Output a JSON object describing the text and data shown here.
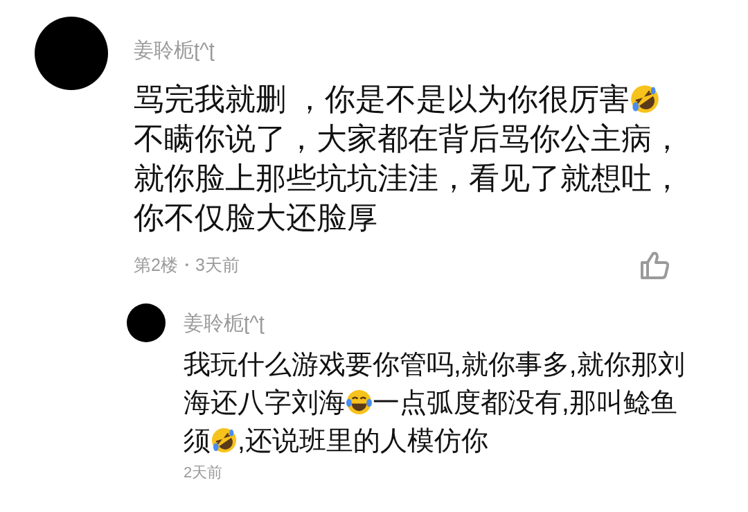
{
  "comments": [
    {
      "user": "姜聆栀ʈ^ʈ",
      "body": [
        {
          "kind": "text",
          "text": "骂完我就删 ，你是不是以为你很厉害"
        },
        {
          "kind": "rofl"
        },
        {
          "kind": "text",
          "text": "不瞒你说了，大家都在背后骂你公主病，就你脸上那些坑坑洼洼，看见了就想吐，你不仅脸大还脸厚"
        }
      ],
      "meta": "第2楼・3天前",
      "replies": [
        {
          "user": "姜聆栀ʈ^ʈ",
          "body": [
            {
              "kind": "text",
              "text": "我玩什么游戏要你管吗,就你事多,就你那刘海还八字刘海"
            },
            {
              "kind": "joy"
            },
            {
              "kind": "text",
              "text": "一点弧度都没有,那叫鲶鱼须"
            },
            {
              "kind": "rofl"
            },
            {
              "kind": "text",
              "text": ",还说班里的人模仿你"
            }
          ],
          "meta": "2天前"
        }
      ]
    }
  ]
}
